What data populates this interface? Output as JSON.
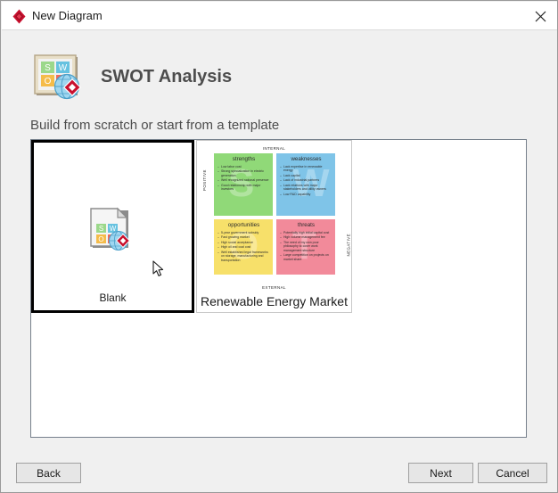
{
  "window": {
    "title": "New Diagram",
    "app_icon": "diagram-app-icon",
    "close_icon": "close-icon"
  },
  "header": {
    "icon": "swot-analysis-icon",
    "title": "SWOT Analysis",
    "subtitle": "Build from scratch or start from a template"
  },
  "icon_letters": {
    "s": "S",
    "w": "W",
    "o": "O"
  },
  "templates": [
    {
      "name": "blank-template",
      "caption": "Blank",
      "selected": true
    },
    {
      "name": "swot-template",
      "caption": "Renewable Energy Market",
      "selected": false
    }
  ],
  "swot_thumbnail": {
    "top_label": "INTERNAL",
    "bottom_label": "EXTERNAL",
    "left_label": "POSITIVE",
    "right_label": "NEGATIVE",
    "ghost_letters": {
      "s": "S",
      "w": "W",
      "o": "O",
      "t": "T"
    },
    "quadrants": {
      "strengths": {
        "title": "strengths",
        "color": "#90d978",
        "items": [
          "Low labor cost",
          "Strong specialization in electric generation",
          "Well recognized national presence",
          "Good relationship with major investors"
        ]
      },
      "weaknesses": {
        "title": "weaknesses",
        "color": "#7fc4e8",
        "items": [
          "Lack expertise in renewable energy",
          "Lack capital",
          "Lack of industrial partners",
          "Lack relations with major stakeholders and utility owners",
          "Low R&D capability"
        ]
      },
      "opportunities": {
        "title": "opportunities",
        "color": "#f7e06a",
        "items": [
          "5-year government subsidy",
          "Fast growing market",
          "High social acceptance",
          "High oil and coal cost",
          "Well established legal frameworks on storage, manufacturing and transportation"
        ]
      },
      "threats": {
        "title": "threats",
        "color": "#f28a9a",
        "items": [
          "Potentially high initial capital cost",
          "High volume management fee",
          "The need of my own poor philosophy to cover work management structure",
          "Large competition on projects on market share"
        ]
      }
    }
  },
  "footer": {
    "back_label": "Back",
    "next_label": "Next",
    "cancel_label": "Cancel"
  },
  "cursor": {
    "icon": "mouse-pointer-icon"
  },
  "colors": {
    "accent_red": "#c8102e",
    "window_bg": "#f0f0f0",
    "panel_bg": "#ffffff",
    "selected_border": "#000000"
  }
}
